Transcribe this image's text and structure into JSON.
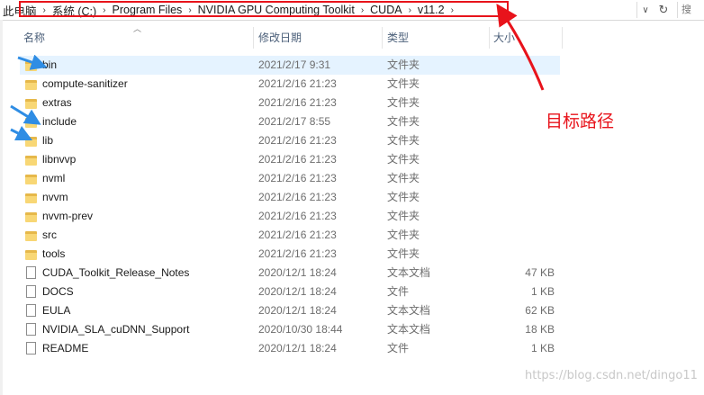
{
  "address_bar": {
    "breadcrumbs": [
      "此电脑",
      "系统 (C:)",
      "Program Files",
      "NVIDIA GPU Computing Toolkit",
      "CUDA",
      "v11.2"
    ],
    "separator": "›",
    "dropdown_glyph": "∨",
    "refresh_glyph": "↻",
    "search_text": "搜"
  },
  "columns": {
    "name": "名称",
    "date": "修改日期",
    "type": "类型",
    "size": "大小"
  },
  "rows": [
    {
      "name": "bin",
      "date": "2021/2/17 9:31",
      "type": "文件夹",
      "size": "",
      "icon": "folder-icon"
    },
    {
      "name": "compute-sanitizer",
      "date": "2021/2/16 21:23",
      "type": "文件夹",
      "size": "",
      "icon": "folder-icon"
    },
    {
      "name": "extras",
      "date": "2021/2/16 21:23",
      "type": "文件夹",
      "size": "",
      "icon": "folder-icon"
    },
    {
      "name": "include",
      "date": "2021/2/17 8:55",
      "type": "文件夹",
      "size": "",
      "icon": "folder-icon"
    },
    {
      "name": "lib",
      "date": "2021/2/16 21:23",
      "type": "文件夹",
      "size": "",
      "icon": "folder-icon"
    },
    {
      "name": "libnvvp",
      "date": "2021/2/16 21:23",
      "type": "文件夹",
      "size": "",
      "icon": "folder-icon"
    },
    {
      "name": "nvml",
      "date": "2021/2/16 21:23",
      "type": "文件夹",
      "size": "",
      "icon": "folder-icon"
    },
    {
      "name": "nvvm",
      "date": "2021/2/16 21:23",
      "type": "文件夹",
      "size": "",
      "icon": "folder-icon"
    },
    {
      "name": "nvvm-prev",
      "date": "2021/2/16 21:23",
      "type": "文件夹",
      "size": "",
      "icon": "folder-icon"
    },
    {
      "name": "src",
      "date": "2021/2/16 21:23",
      "type": "文件夹",
      "size": "",
      "icon": "folder-icon"
    },
    {
      "name": "tools",
      "date": "2021/2/16 21:23",
      "type": "文件夹",
      "size": "",
      "icon": "folder-icon"
    },
    {
      "name": "CUDA_Toolkit_Release_Notes",
      "date": "2020/12/1 18:24",
      "type": "文本文档",
      "size": "47 KB",
      "icon": "text-file-icon"
    },
    {
      "name": "DOCS",
      "date": "2020/12/1 18:24",
      "type": "文件",
      "size": "1 KB",
      "icon": "file-icon"
    },
    {
      "name": "EULA",
      "date": "2020/12/1 18:24",
      "type": "文本文档",
      "size": "62 KB",
      "icon": "text-file-icon"
    },
    {
      "name": "NVIDIA_SLA_cuDNN_Support",
      "date": "2020/10/30 18:44",
      "type": "文本文档",
      "size": "18 KB",
      "icon": "text-file-icon"
    },
    {
      "name": "README",
      "date": "2020/12/1 18:24",
      "type": "文件",
      "size": "1 KB",
      "icon": "file-icon"
    }
  ],
  "annotation": {
    "label": "目标路径",
    "color": "#e8131b",
    "arrow_color": "#2f8de4"
  },
  "watermark": "https://blog.csdn.net/dingo11"
}
